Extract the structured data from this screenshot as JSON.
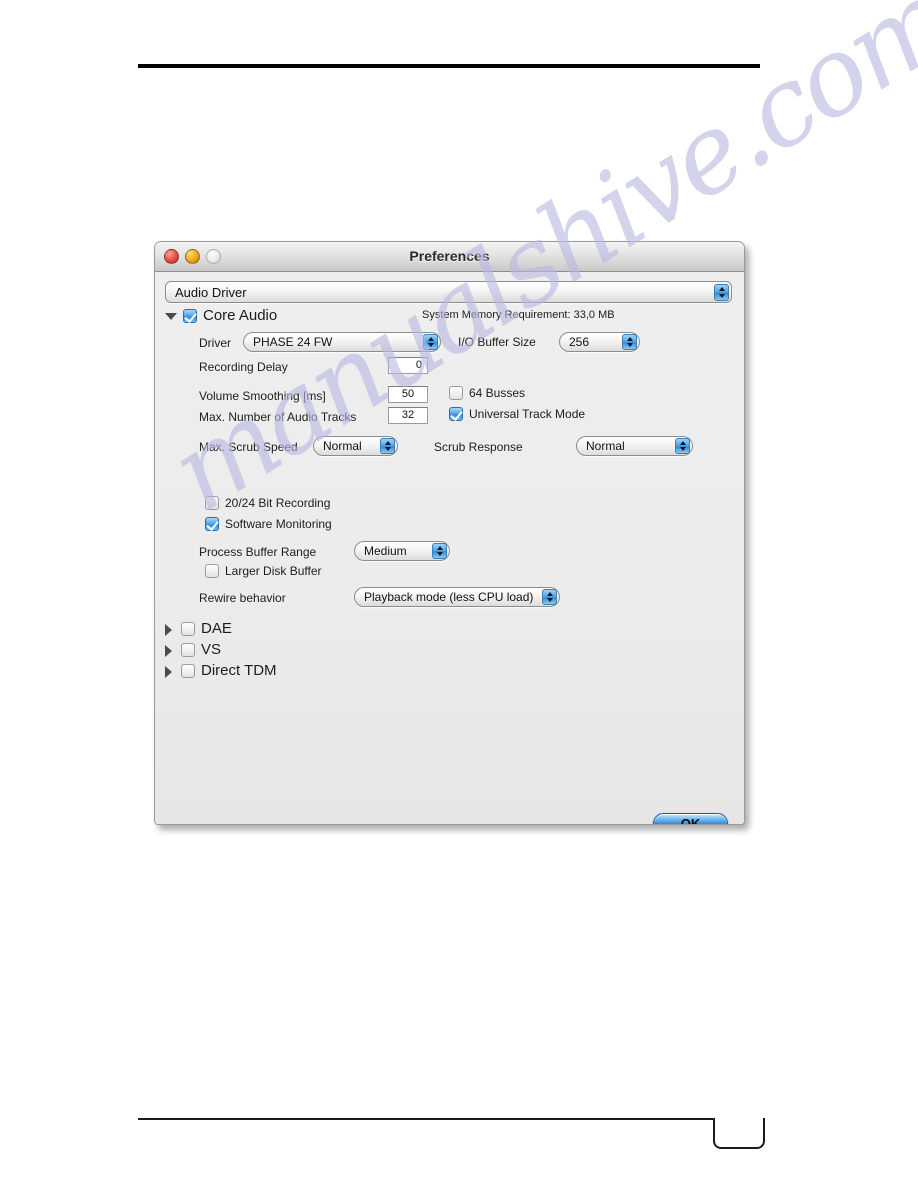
{
  "watermark": {
    "text": "manualshive.com"
  },
  "window": {
    "title": "Preferences",
    "traffic_lights": [
      {
        "name": "close",
        "color": "#e8564b"
      },
      {
        "name": "minimize",
        "color": "#f5ab21"
      },
      {
        "name": "zoom",
        "color": "#ededed"
      }
    ],
    "category_popup": {
      "value": "Audio Driver"
    },
    "sections": [
      {
        "id": "core-audio",
        "label": "Core Audio",
        "expanded": true,
        "checked": true,
        "memory_info": "System Memory Requirement: 33,0 MB"
      },
      {
        "id": "dae",
        "label": "DAE",
        "expanded": false,
        "checked": false
      },
      {
        "id": "vs",
        "label": "VS",
        "expanded": false,
        "checked": false
      },
      {
        "id": "direct-tdm",
        "label": "Direct TDM",
        "expanded": false,
        "checked": false
      }
    ],
    "fields": {
      "driver_label": "Driver",
      "driver_value": "PHASE 24 FW",
      "io_buffer_label": "I/O Buffer Size",
      "io_buffer_value": "256",
      "recording_delay_label": "Recording Delay",
      "recording_delay_value": "0",
      "volume_smoothing_label": "Volume Smoothing [ms]",
      "volume_smoothing_value": "50",
      "max_tracks_label": "Max. Number of Audio Tracks",
      "max_tracks_value": "32",
      "busses_label": "64 Busses",
      "busses_checked": false,
      "universal_track_label": "Universal Track Mode",
      "universal_track_checked": true,
      "max_scrub_label": "Max. Scrub Speed",
      "max_scrub_value": "Normal",
      "scrub_response_label": "Scrub Response",
      "scrub_response_value": "Normal",
      "bit_recording_label": "20/24 Bit Recording",
      "bit_recording_checked": false,
      "software_monitoring_label": "Software Monitoring",
      "software_monitoring_checked": true,
      "process_buffer_label": "Process Buffer Range",
      "process_buffer_value": "Medium",
      "larger_disk_label": "Larger Disk Buffer",
      "larger_disk_checked": false,
      "rewire_label": "Rewire behavior",
      "rewire_value": "Playback mode (less CPU load)"
    },
    "ok_button": "OK"
  }
}
